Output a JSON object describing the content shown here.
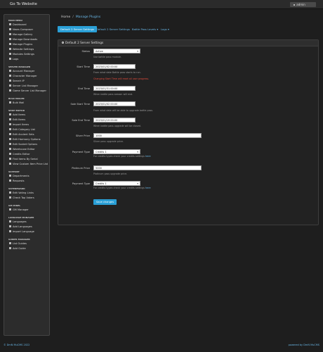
{
  "header": {
    "title": "Go To Website",
    "user_button": "admin"
  },
  "sidebar": [
    {
      "section": "MAIN MENU",
      "items": [
        "Dashboard",
        "News Composer",
        "Manage Gallery",
        "Manage Downloads",
        "Manage Plugins",
        "Website Settings",
        "Modules Settings",
        "Logs"
      ]
    },
    {
      "section": "SERVER MANAGER",
      "items": [
        "Account Manager",
        "Character Manager",
        "Search IP",
        "Server List Manager",
        "Game Server List Manager"
      ]
    },
    {
      "section": "BULK MAILER",
      "items": [
        "Bulk Mail"
      ]
    },
    {
      "section": "SHOP EDITOR",
      "items": [
        "Add Items",
        "Edit Items",
        "Import Items",
        "Edit Category List",
        "Edit Ancient Sets",
        "Edit Harmony Options",
        "Edit Socket Options",
        "Warehouse Editor",
        "Credits Editor",
        "Find Items By Serial",
        "View Custom Item Price List"
      ]
    },
    {
      "section": "SUPPORT",
      "items": [
        "Departments",
        "Requests"
      ]
    },
    {
      "section": "VOTEREWARD",
      "items": [
        "Edit Voting Links",
        "Check Top Voters"
      ]
    },
    {
      "section": "GM PANEL",
      "items": [
        "GM Manager"
      ]
    },
    {
      "section": "LANGUAGE MANAGER",
      "items": [
        "Languages",
        "Add Languages",
        "Import Language"
      ]
    },
    {
      "section": "GUIDES MANAGER",
      "items": [
        "List Guides",
        "Add Guide"
      ]
    }
  ],
  "breadcrumb": {
    "home": "Home",
    "separator": "/",
    "current": "Manage Plugins"
  },
  "tabs": [
    "Default 2 Server Settings",
    "Default 2 Server Settings",
    "Battle Pass Levels",
    "Logs"
  ],
  "panel_title": "Default 2 Server Settings",
  "form": {
    "status": {
      "label": "Status",
      "value": "Active",
      "help": "Use battle pass module."
    },
    "start_time": {
      "label": "Start Time",
      "value": "2023/01/02 00:00",
      "help": "From what date Battle pass starts to run.",
      "warning": "Changing Start Time will reset all user progress."
    },
    "end_time": {
      "label": "End Time",
      "value": "2023/01/31 00:00",
      "help": "When battle pass season will end."
    },
    "sale_start": {
      "label": "Sale Start Time",
      "value": "2023/01/02 00:00",
      "help": "From what date will be able to upgrade battle pass."
    },
    "sale_end": {
      "label": "Sale End Time",
      "value": "2023/01/19 00:00",
      "help": "When battle pass upgrade will be closed."
    },
    "silver_price": {
      "label": "Silver Price",
      "value": "1000",
      "help": "Silver pass upgrade price."
    },
    "payment_type_1": {
      "label": "Payment Type",
      "value": "Credits 1",
      "help_prefix": "For credits types check your credits settings",
      "help_link": "here"
    },
    "platinum_price": {
      "label": "Platinum Price",
      "value": "5000",
      "help": "Platinum pass upgrade price."
    },
    "payment_type_2": {
      "label": "Payment Type",
      "value": "Credits 1",
      "help_prefix": "For credits types check your credits settings",
      "help_link": "here"
    },
    "save_label": "Save changes"
  },
  "footer": {
    "left": "© DmN MuCMS 2022",
    "right_prefix": "powered by",
    "right_link": "DmN MuCMS"
  },
  "colors": {
    "accent": "#2a9fd6",
    "warning": "#e74c3c",
    "background": "#1e1e1e"
  }
}
